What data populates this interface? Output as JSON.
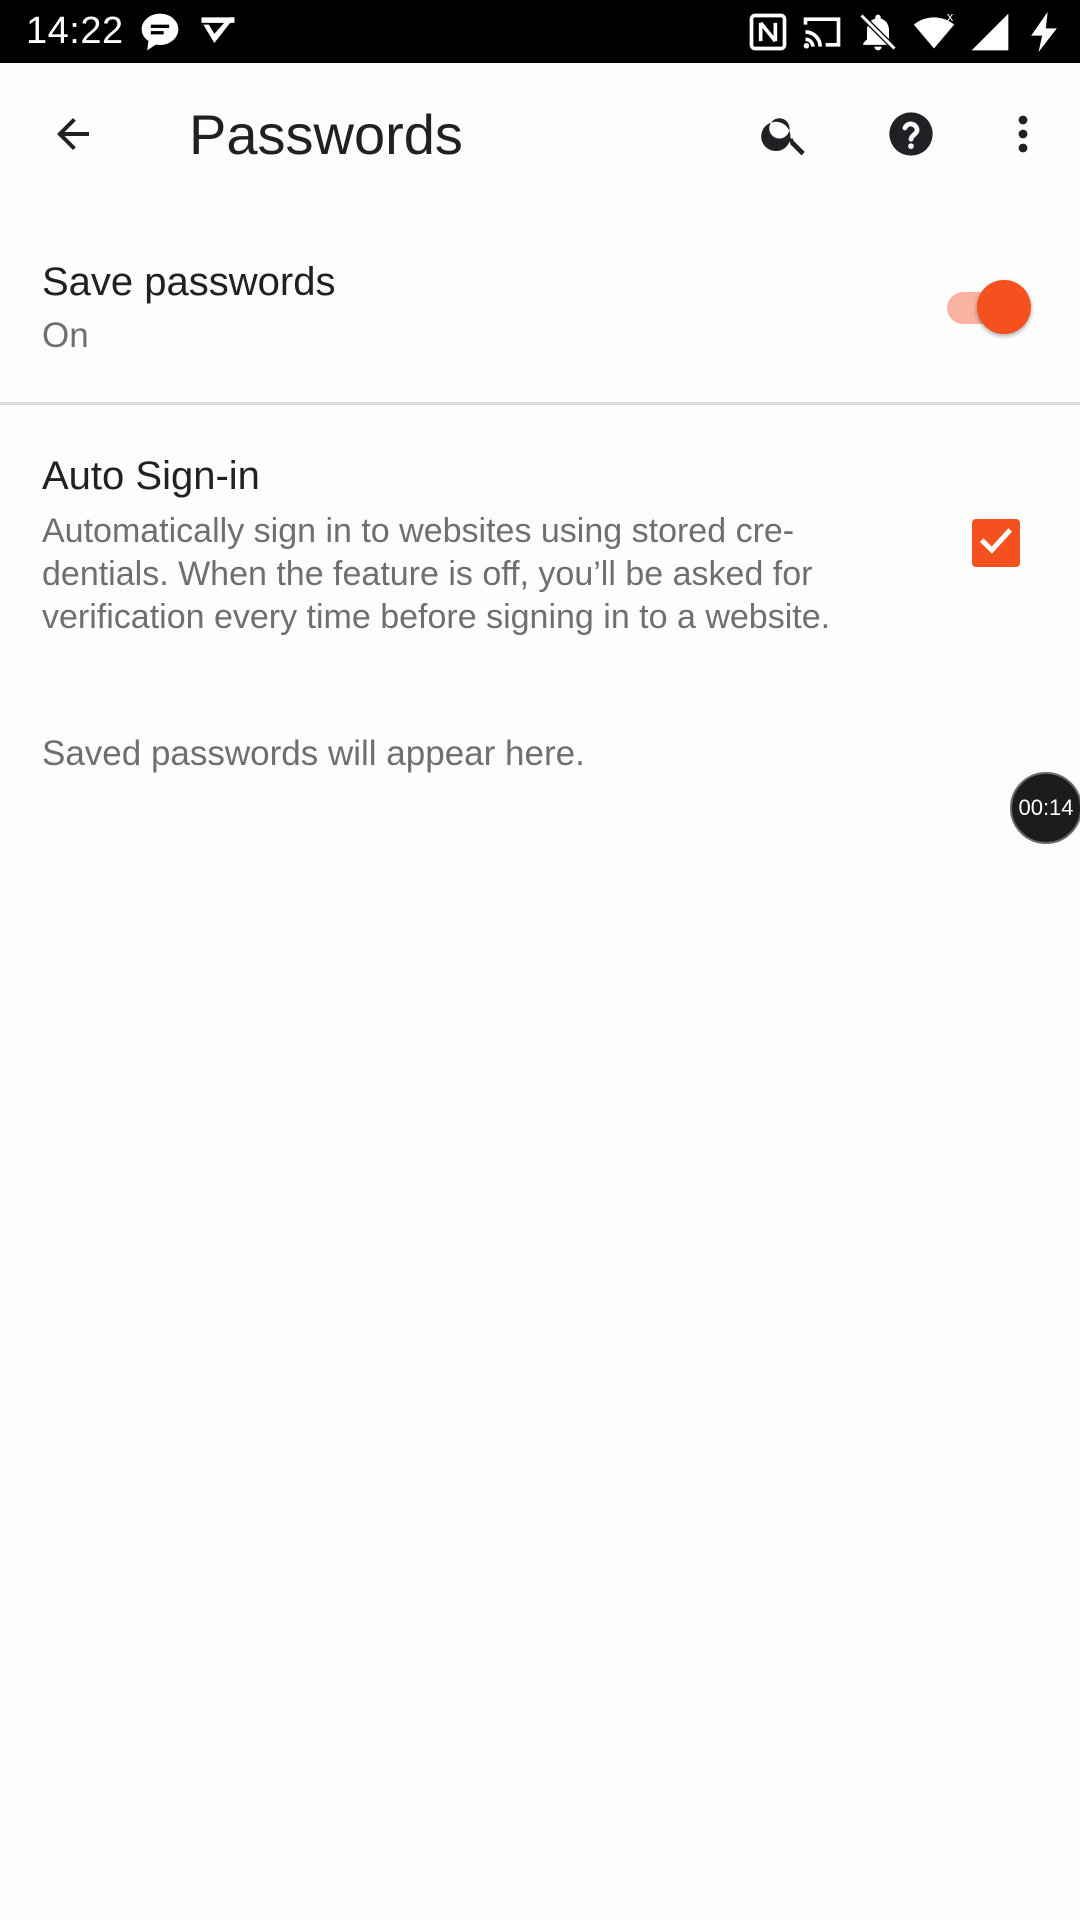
{
  "status_bar": {
    "time": "14:22",
    "icons_left": [
      "chat-bubble-icon",
      "tasks-icon"
    ],
    "icons_right": [
      "nfc-icon",
      "cast-icon",
      "notifications-off-icon",
      "wifi-icon",
      "signal-icon",
      "charging-icon"
    ]
  },
  "app_bar": {
    "title": "Passwords",
    "back_icon": "arrow-back-icon",
    "search_icon": "search-icon",
    "help_icon": "help-icon",
    "more_icon": "more-vert-icon"
  },
  "save_passwords": {
    "title": "Save passwords",
    "state_label": "On",
    "enabled": true
  },
  "auto_signin": {
    "title": "Auto Sign-in",
    "description_lines": [
      "Automatically sign in to websites using stored cre-",
      "dentials. When the feature is off, you’ll be asked for",
      "verification every time before signing in to a website."
    ],
    "checked": true
  },
  "empty_state": "Saved passwords will appear here.",
  "timer_badge": "00:14",
  "colors": {
    "accent": "#f4511e",
    "accent_track": "#f8b3a1",
    "text_primary": "#202124",
    "text_secondary": "#6f6f6f",
    "status_bar": "#000000",
    "background": "#fdfefc"
  }
}
